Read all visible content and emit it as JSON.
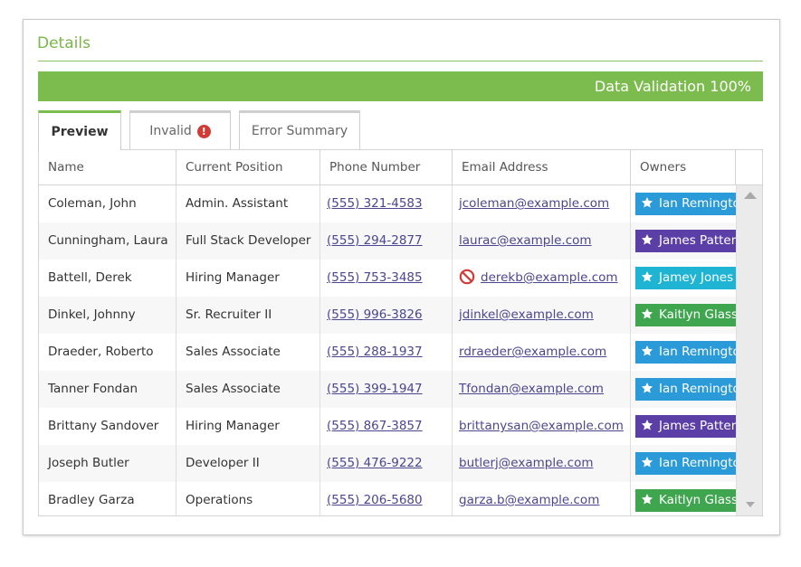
{
  "card": {
    "title": "Details",
    "validation_label": "Data Validation 100%",
    "validation_percent": 100
  },
  "tabs": [
    {
      "label": "Preview",
      "active": true
    },
    {
      "label": "Invalid",
      "active": false,
      "badge": "!"
    },
    {
      "label": "Error Summary",
      "active": false
    }
  ],
  "table": {
    "columns": [
      "Name",
      "Current Position",
      "Phone Number",
      "Email Address",
      "Owners"
    ],
    "rows": [
      {
        "name": "Coleman, John",
        "position": "Admin. Assistant",
        "phone": "(555) 321-4583",
        "email": "jcoleman@example.com",
        "email_invalid": false,
        "owner": "Ian Remington",
        "owner_color": "#2b9ad8"
      },
      {
        "name": "Cunningham, Laura",
        "position": "Full Stack Developer",
        "phone": "(555) 294-2877",
        "email": "laurac@example.com",
        "email_invalid": false,
        "owner": "James Patterson",
        "owner_color": "#5b3ea6"
      },
      {
        "name": "Battell, Derek",
        "position": "Hiring Manager",
        "phone": "(555) 753-3485",
        "email": "derekb@example.com",
        "email_invalid": true,
        "owner": "Jamey Jones",
        "owner_color": "#1fb3d4"
      },
      {
        "name": "Dinkel, Johnny",
        "position": "Sr. Recruiter II",
        "phone": "(555) 996-3826",
        "email": "jdinkel@example.com",
        "email_invalid": false,
        "owner": "Kaitlyn Glass",
        "owner_color": "#3fa64f"
      },
      {
        "name": "Draeder, Roberto",
        "position": "Sales Associate",
        "phone": "(555) 288-1937",
        "email": "rdraeder@example.com",
        "email_invalid": false,
        "owner": "Ian Remington",
        "owner_color": "#2b9ad8"
      },
      {
        "name": "Tanner Fondan",
        "position": "Sales Associate",
        "phone": "(555) 399-1947",
        "email": "Tfondan@example.com",
        "email_invalid": false,
        "owner": "Ian Remington",
        "owner_color": "#2b9ad8"
      },
      {
        "name": "Brittany Sandover",
        "position": "Hiring Manager",
        "phone": "(555) 867-3857",
        "email": "brittanysan@example.com",
        "email_invalid": false,
        "owner": "James Patterson",
        "owner_color": "#5b3ea6"
      },
      {
        "name": "Joseph Butler",
        "position": "Developer II",
        "phone": "(555) 476-9222",
        "email": "butlerj@example.com",
        "email_invalid": false,
        "owner": "Ian Remington",
        "owner_color": "#2b9ad8"
      },
      {
        "name": "Bradley Garza",
        "position": "Operations",
        "phone": "(555) 206-5680",
        "email": "garza.b@example.com",
        "email_invalid": false,
        "owner": "Kaitlyn Glass",
        "owner_color": "#3fa64f"
      }
    ]
  },
  "colors": {
    "accent": "#7cbc4f",
    "link": "#4a4690",
    "error": "#d23b36"
  },
  "icons": {
    "invalid_badge": "exclamation-circle-icon",
    "invalid_email": "no-entry-icon",
    "owner": "star-icon"
  }
}
